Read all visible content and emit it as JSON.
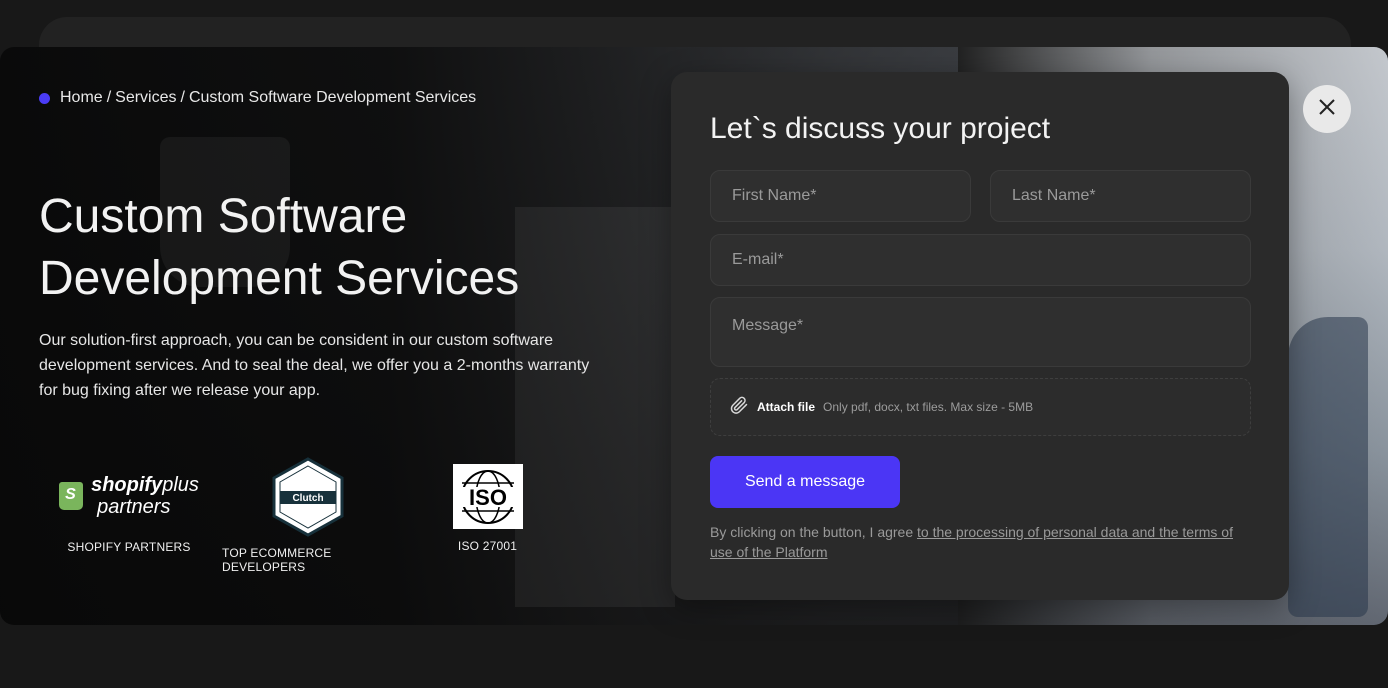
{
  "breadcrumb": {
    "home": "Home",
    "services": "Services",
    "current": "Custom Software Development Services",
    "separator": "/"
  },
  "hero": {
    "title_line1": "Custom Software",
    "title_line2": "Development Services",
    "description": "Our solution-first approach, you can be consident in our custom software development services. And to seal the deal, we offer you a 2-months warranty for bug fixing after we release your app."
  },
  "badges": [
    {
      "logo_text_a": "shopify",
      "logo_text_b": "plus",
      "logo_text_c": "partners",
      "caption": "SHOPIFY PARTNERS"
    },
    {
      "logo_text": "Clutch",
      "caption": "TOP ECOMMERCE DEVELOPERS"
    },
    {
      "logo_text": "ISO",
      "caption": "ISO 27001"
    }
  ],
  "form": {
    "title": "Let`s discuss your project",
    "first_name_placeholder": "First Name*",
    "last_name_placeholder": "Last Name*",
    "email_placeholder": "E-mail*",
    "message_placeholder": "Message*",
    "attach_label": "Attach file",
    "attach_hint": "Only pdf, docx, txt files. Max size - 5MB",
    "submit_label": "Send a message",
    "consent_prefix": "By clicking on the button, I agree ",
    "consent_link": "to the processing of personal data and the terms of use of the Platform"
  },
  "colors": {
    "accent": "#4b36f5",
    "panel_bg": "#2a2a2a",
    "page_bg": "#181818"
  },
  "icons": {
    "close": "close-icon",
    "attach": "paperclip-icon",
    "breadcrumb_dot": "dot-icon"
  }
}
